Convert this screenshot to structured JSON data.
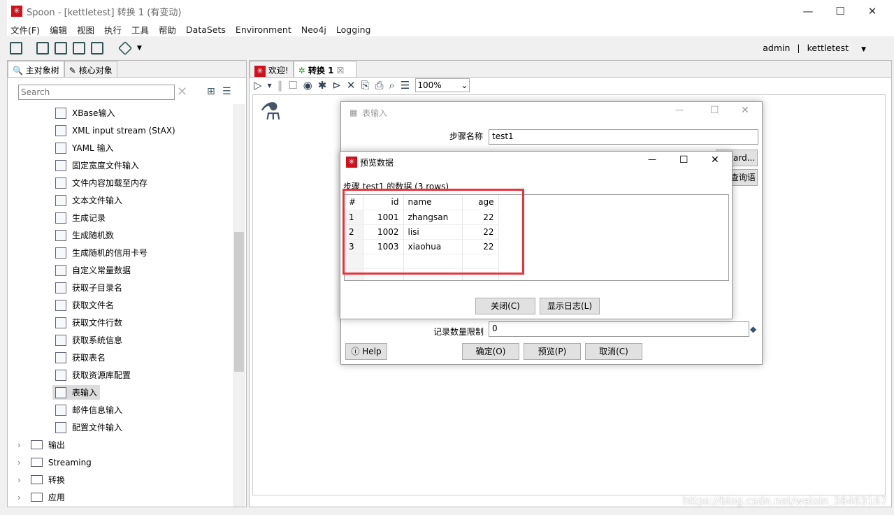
{
  "window": {
    "title": "Spoon - [kettletest] 转换 1 (有变动)",
    "min": "—",
    "max": "☐",
    "close": "✕"
  },
  "menu": [
    "文件(F)",
    "编辑",
    "视图",
    "执行",
    "工具",
    "帮助",
    "DataSets",
    "Environment",
    "Neo4j",
    "Logging"
  ],
  "user": {
    "name": "admin",
    "sep": "|",
    "repo": "kettletest",
    "caret": "▼"
  },
  "left": {
    "tabs": [
      "主对象树",
      "核心对象"
    ],
    "search_placeholder": "Search",
    "items": [
      "XBase输入",
      "XML input stream (StAX)",
      "YAML 输入",
      "固定宽度文件输入",
      "文件内容加载至内存",
      "文本文件输入",
      "生成记录",
      "生成随机数",
      "生成随机的信用卡号",
      "自定义常量数据",
      "获取子目录名",
      "获取文件名",
      "获取文件行数",
      "获取系统信息",
      "获取表名",
      "获取资源库配置",
      "表输入",
      "邮件信息输入",
      "配置文件输入"
    ],
    "selected": "表输入",
    "folders": [
      "输出",
      "Streaming",
      "转换",
      "应用"
    ]
  },
  "main": {
    "tabs": [
      "欢迎!",
      "转换 1"
    ],
    "zoom": "100%"
  },
  "table_input": {
    "title": "表输入",
    "step_name_label": "步骤名称",
    "step_name": "test1",
    "wizard_btn": "Wizard...",
    "sql_btn": "获取SQL查询语句...",
    "limit_label": "记录数量限制",
    "limit": "0",
    "help": "Help",
    "ok": "确定(O)",
    "preview": "预览(P)",
    "cancel": "取消(C)"
  },
  "preview": {
    "title": "预览数据",
    "caption": "步骤 test1 的数据  (3 rows)",
    "columns": [
      "#",
      "id",
      "name",
      "age"
    ],
    "rows": [
      [
        "1",
        "1001",
        "zhangsan",
        "22"
      ],
      [
        "2",
        "1002",
        "lisi",
        "22"
      ],
      [
        "3",
        "1003",
        "xiaohua",
        "22"
      ]
    ],
    "close": "关闭(C)",
    "showlog": "显示日志(L)",
    "highlight_color": "#e8333a"
  },
  "watermark": "https://blog.csdn.net/weixin_38463167"
}
